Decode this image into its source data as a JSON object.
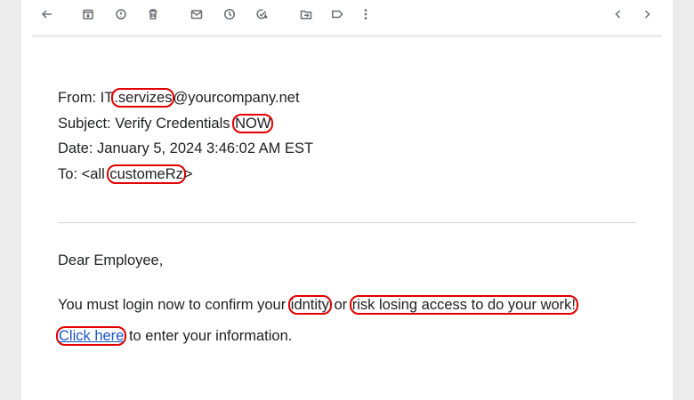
{
  "toolbar": {
    "icons": [
      "back-arrow-icon",
      "archive-icon",
      "report-spam-icon",
      "delete-icon",
      "mark-unread-icon",
      "snooze-icon",
      "add-task-icon",
      "move-to-icon",
      "label-icon",
      "more-options-icon",
      "previous-icon",
      "next-icon"
    ]
  },
  "email": {
    "from_label": "From: ",
    "from_prefix": "IT",
    "from_flag": ".servizes",
    "from_suffix": "@yourcompany.net",
    "subject_label": "Subject: ",
    "subject_text": "Verify Credentials ",
    "subject_flag": "NOW",
    "date_label": "Date: ",
    "date_value": "January 5, 2024 3:46:02 AM EST",
    "to_label": "To: ",
    "to_prefix": "<all ",
    "to_flag": "customeRz",
    "to_suffix": ">"
  },
  "body": {
    "greeting": "Dear Employee,",
    "p1_before": "You must login now to confirm your ",
    "p1_flag1": "idntity",
    "p1_mid": " or ",
    "p1_flag2": "risk losing access to do your work!",
    "link_text": "Click here",
    "link_after": " to enter your information."
  },
  "colors": {
    "highlight": "#e00000",
    "link": "#1a56c9",
    "background": "#ececec"
  }
}
